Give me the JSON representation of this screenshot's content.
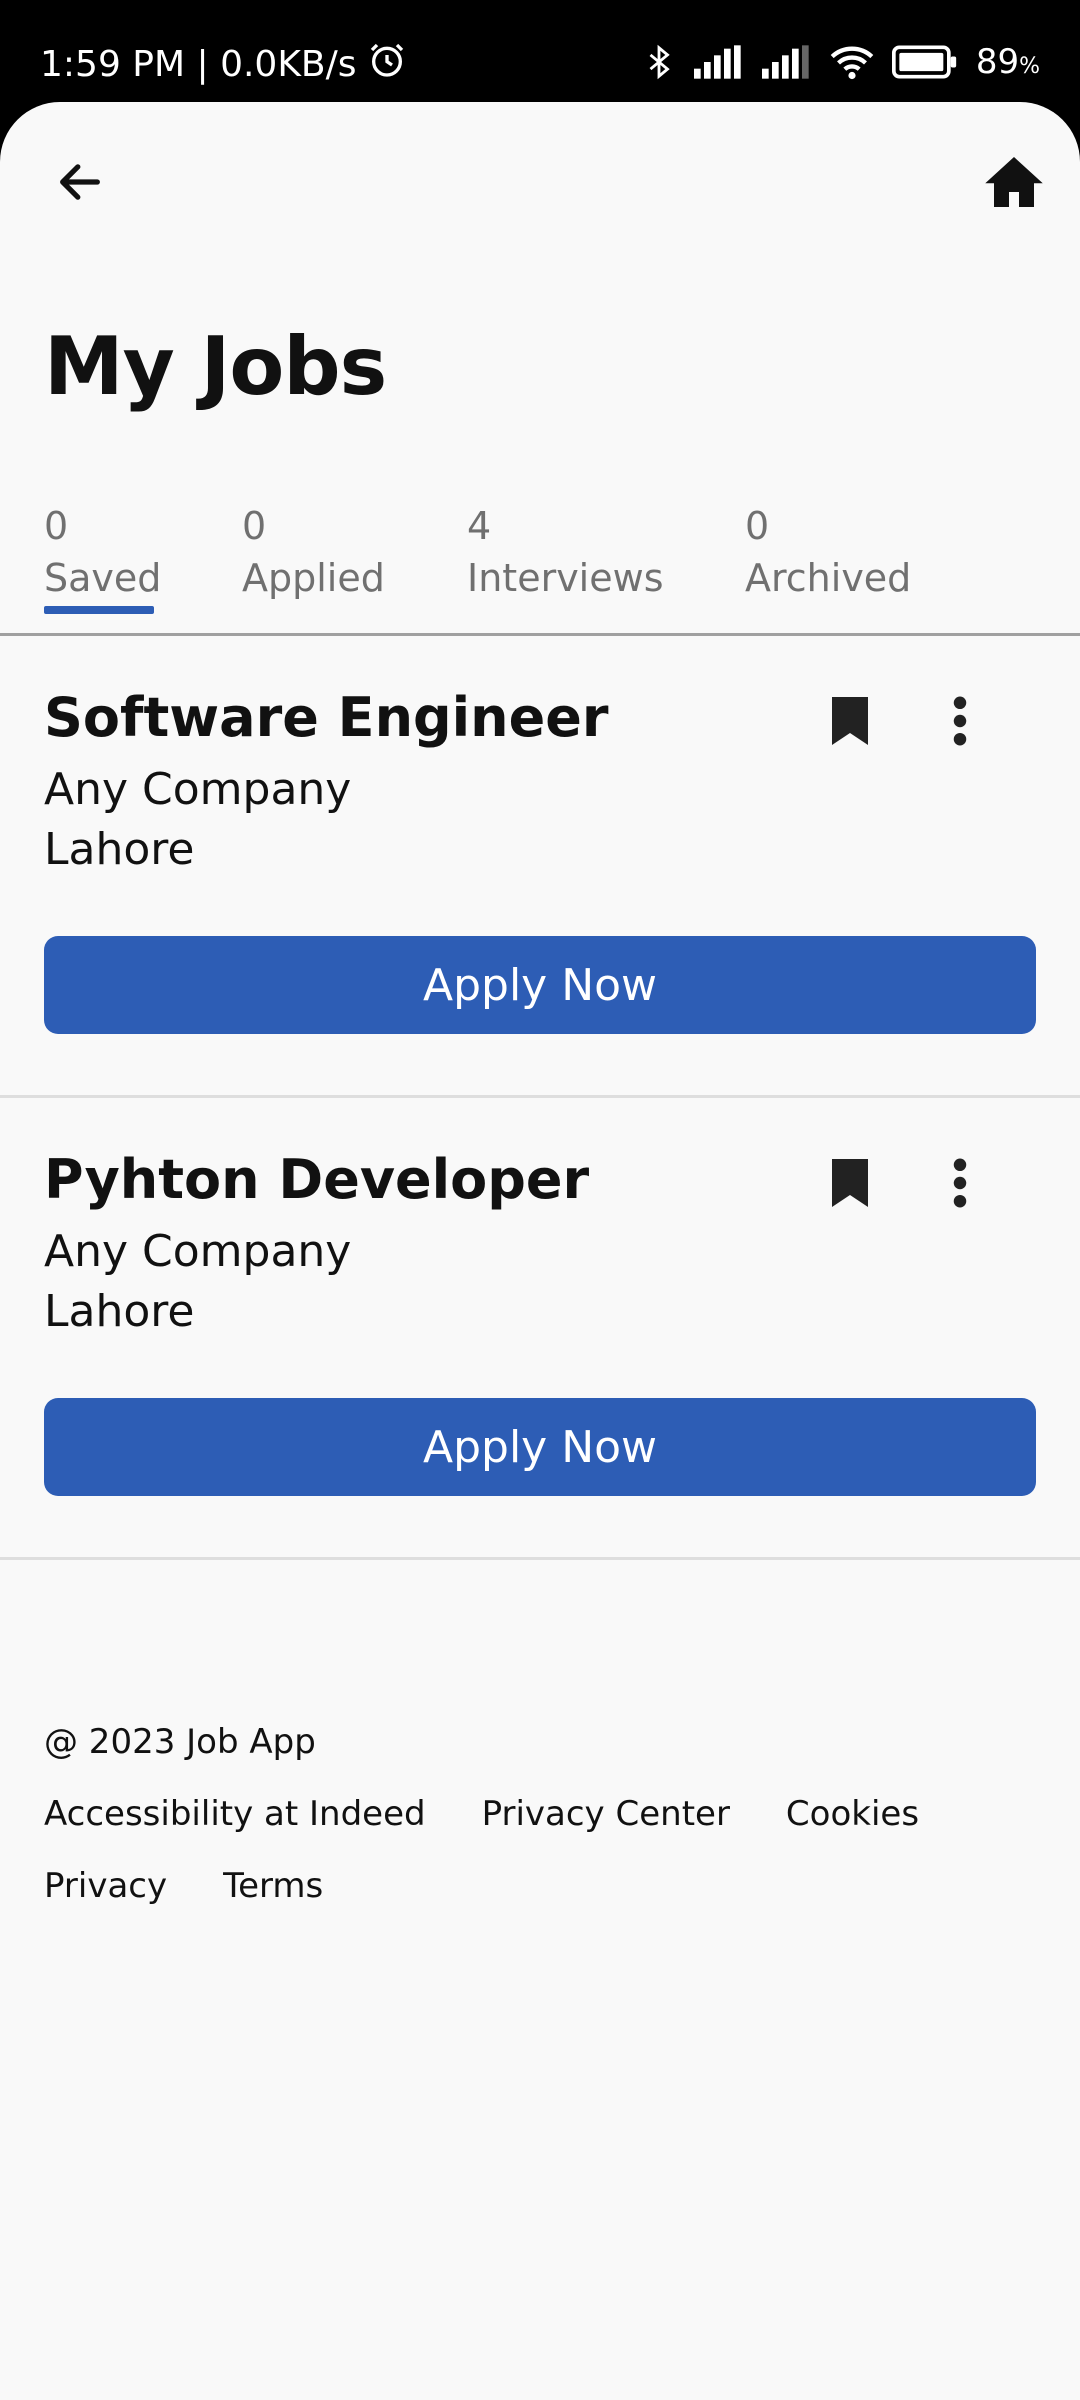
{
  "status_bar": {
    "time_info": "1:59 PM | 0.0KB/s",
    "battery": "89",
    "battery_unit": "%",
    "icons": [
      "alarm-icon",
      "bluetooth-icon",
      "signal-icon",
      "signal-icon",
      "wifi-icon",
      "battery-icon"
    ]
  },
  "header": {
    "back_icon": "arrow-left-icon",
    "home_icon": "home-icon",
    "title": "My Jobs"
  },
  "tabs": [
    {
      "count": "0",
      "label": "Saved",
      "active": true
    },
    {
      "count": "0",
      "label": "Applied",
      "active": false
    },
    {
      "count": "4",
      "label": "Interviews",
      "active": false
    },
    {
      "count": "0",
      "label": "Archived",
      "active": false
    }
  ],
  "jobs": [
    {
      "title": "Software Engineer",
      "company": "Any Company",
      "location": "Lahore",
      "button": "Apply Now"
    },
    {
      "title": "Pyhton Developer",
      "company": "Any Company",
      "location": "Lahore",
      "button": "Apply Now"
    }
  ],
  "footer": {
    "copyright": "@ 2023 Job App",
    "links_row1": [
      "Accessibility at Indeed",
      "Privacy Center",
      "Cookies"
    ],
    "links_row2": [
      "Privacy",
      "Terms"
    ]
  },
  "colors": {
    "accent": "#2d5db5",
    "background": "#f9f9f9",
    "tab_text": "#707070"
  }
}
